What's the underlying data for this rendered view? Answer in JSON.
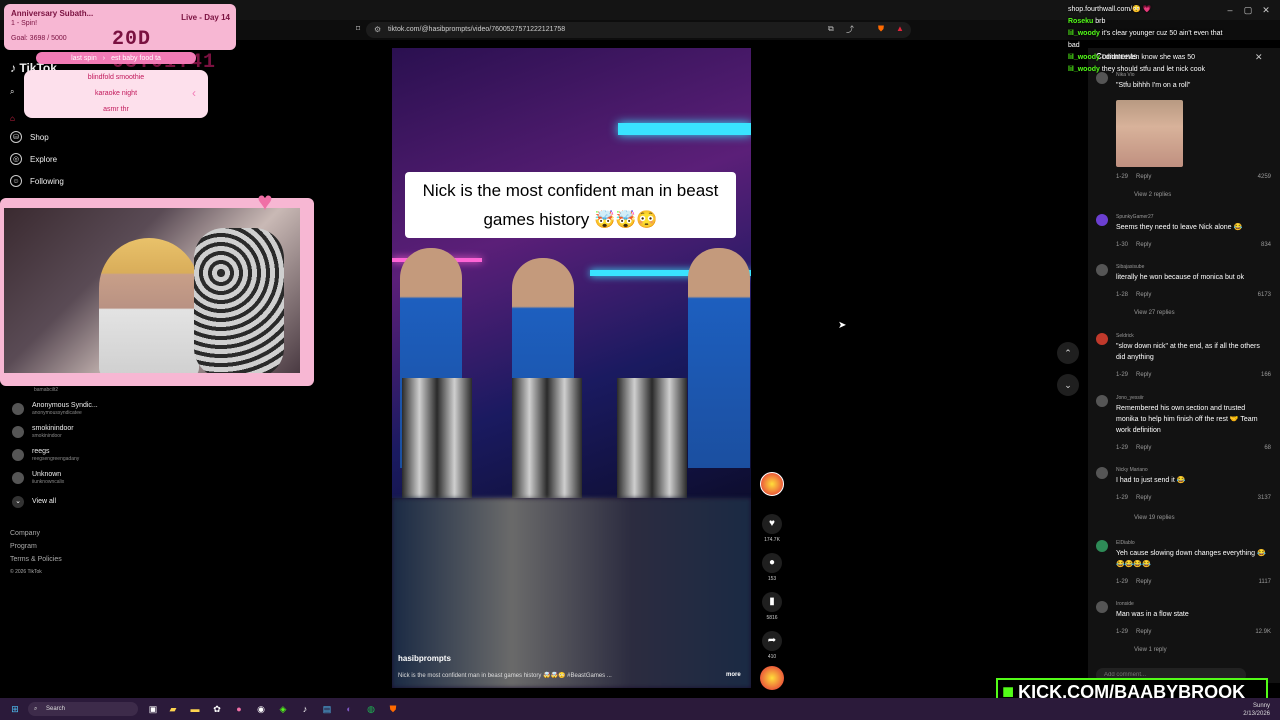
{
  "browser": {
    "url": "tiktok.com/@hasibprompts/video/7600527571222121758"
  },
  "subathon": {
    "title": "Anniversary Subath...",
    "live": "Live - Day 14",
    "spin": "1 - Spin!",
    "goal": "Goal: 3698 / 5000",
    "timer": "20D 03:01:41"
  },
  "spin_wheel": {
    "current": "last spin",
    "next": "est baby food ta",
    "items": [
      "blindfold smoothie",
      "karaoke night",
      "asmr thr"
    ]
  },
  "sidebar": {
    "items": [
      {
        "label": "Shop",
        "icon": "shop-icon"
      },
      {
        "label": "Explore",
        "icon": "compass-icon"
      },
      {
        "label": "Following",
        "icon": "following-icon"
      }
    ],
    "accounts": [
      {
        "name": "Anonymous Syndic...",
        "handle": "anonymoussyndicatee"
      },
      {
        "name": "smokinindoor",
        "handle": "smokinindoor"
      },
      {
        "name": "reegs",
        "handle": "reegsengreengadany"
      },
      {
        "name": "Unknown",
        "handle": "iiunknowncalix"
      }
    ],
    "view_all": "View all",
    "partial_handle": "bamabcilt2",
    "footer": [
      "Company",
      "Program",
      "Terms & Policies",
      "© 2026 TikTok"
    ]
  },
  "video": {
    "caption": "Nick is the most confident man in beast games history 🤯🤯😳",
    "username": "hasibprompts",
    "description": "Nick is the most confident man in beast games history 🤯🤯😳 #BeastGames ...",
    "more": "more",
    "likes": "174.7K",
    "comments": "153",
    "saves": "5816",
    "shares": "410"
  },
  "comments_header": "Comments",
  "comments": [
    {
      "user": "Nika Vio",
      "text": "\"Stfu bihhh I'm on a roll\"",
      "time": "1-29",
      "reply": "Reply",
      "likes": "4259",
      "views": "View 2 replies"
    },
    {
      "user": "SpunkyGamer27",
      "text": "Seems they need to leave Nick alone 😂",
      "time": "1-30",
      "reply": "Reply",
      "likes": "834",
      "views": ""
    },
    {
      "user": "Sibajasisube",
      "text": "literally he won because of monica but ok",
      "time": "1-28",
      "reply": "Reply",
      "likes": "6173",
      "views": "View 27 replies"
    },
    {
      "user": "Seldrick",
      "text": "\"slow down nick\" at the end, as if all the others did anything",
      "time": "1-29",
      "reply": "Reply",
      "likes": "166",
      "views": ""
    },
    {
      "user": "Jono_yessiir",
      "text": "Remembered his own section and trusted monika to help him finish off the rest 🤝 Team work definition",
      "time": "1-29",
      "reply": "Reply",
      "likes": "68",
      "views": ""
    },
    {
      "user": "Nicky Mariano",
      "text": "I had to just send it 😂",
      "time": "1-29",
      "reply": "Reply",
      "likes": "3137",
      "views": "View 19 replies"
    },
    {
      "user": "ElDiablo",
      "text": "Yeh cause slowing down changes everything 😂😂😂😂😂",
      "time": "1-29",
      "reply": "Reply",
      "likes": "1117",
      "views": ""
    },
    {
      "user": "Ironside",
      "text": "Man was in a flow state",
      "time": "1-29",
      "reply": "Reply",
      "likes": "12.9K",
      "views": "View 1 reply"
    }
  ],
  "comment_input_placeholder": "Add comment...",
  "chat": [
    {
      "user": "",
      "text": "shop.fourthwall.com/😳 💗"
    },
    {
      "user": "Roseku",
      "text": "brb"
    },
    {
      "user": "lil_woody",
      "text": "it's clear younger cuz 50 ain't even that"
    },
    {
      "user": "",
      "text": "bad"
    },
    {
      "user": "lil_woody",
      "text": "I didn't even know she was 50"
    },
    {
      "user": "lil_woody",
      "text": "they should stfu and let nick cook"
    }
  ],
  "kick_banner": "KICK.COM/BAABYBROOK",
  "taskbar": {
    "search": "Search",
    "weather": "Sunny",
    "date": "2/13/2026"
  },
  "colors": {
    "accent_pink": "#f7b7d3",
    "kick_green": "#53fc18",
    "neon_cyan": "#39e3ff"
  }
}
